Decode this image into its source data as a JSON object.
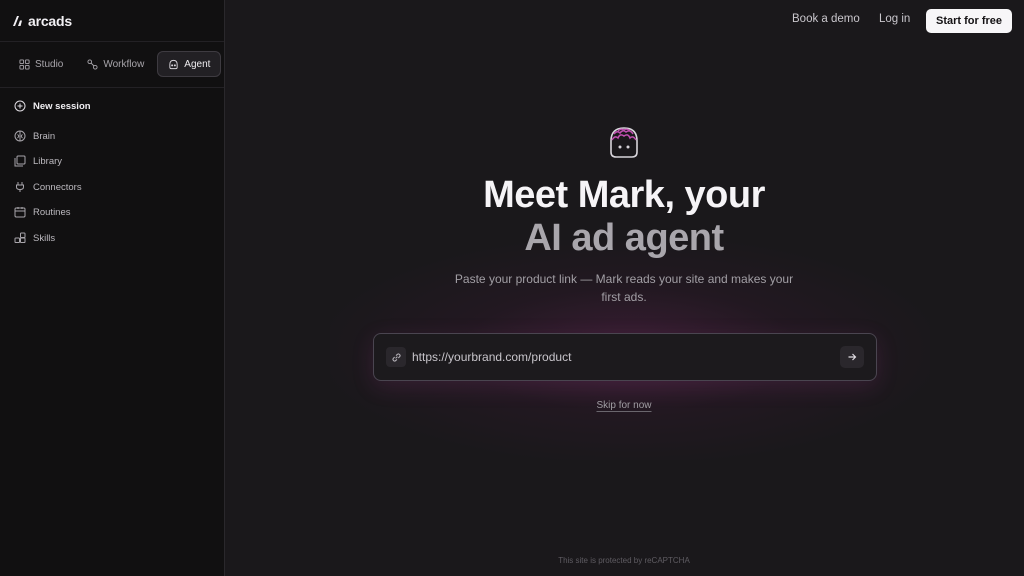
{
  "brand": {
    "name": "arcads"
  },
  "sidebar": {
    "tabs": [
      {
        "label": "Studio",
        "icon": "grid-icon",
        "active": false
      },
      {
        "label": "Workflow",
        "icon": "workflow-icon",
        "active": false
      },
      {
        "label": "Agent",
        "icon": "agent-icon",
        "active": true
      }
    ],
    "new_session": {
      "label": "New session",
      "icon": "plus-circle-icon"
    },
    "items": [
      {
        "label": "Brain",
        "icon": "brain-icon"
      },
      {
        "label": "Library",
        "icon": "library-icon"
      },
      {
        "label": "Connectors",
        "icon": "plug-icon"
      },
      {
        "label": "Routines",
        "icon": "calendar-icon"
      },
      {
        "label": "Skills",
        "icon": "blocks-icon"
      }
    ]
  },
  "header": {
    "book_demo": "Book a demo",
    "login": "Log in",
    "cta": "Start for free"
  },
  "hero": {
    "mascot_icon": "mark-mascot-icon",
    "headline_line1": "Meet Mark, your",
    "headline_line2": "AI ad agent",
    "subtitle": "Paste your product link — Mark reads your site and makes your first ads."
  },
  "url_form": {
    "placeholder": "https://yourbrand.com/product",
    "value": "",
    "link_icon": "link-icon",
    "submit_icon": "arrow-right-icon"
  },
  "skip_label": "Skip for now",
  "footer": {
    "recaptcha": "This site is protected by reCAPTCHA"
  },
  "colors": {
    "background": "#1a181b",
    "sidebar": "#111011",
    "accent": "#c04fb0",
    "cta_bg": "#f7f6f8"
  }
}
